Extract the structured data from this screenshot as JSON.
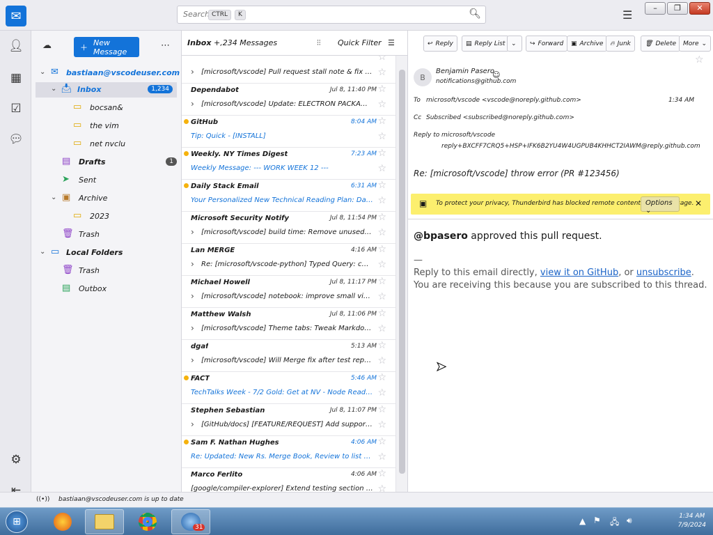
{
  "search": {
    "placeholder": "Search…",
    "kbd1": "CTRL",
    "kbd2": "K"
  },
  "spaces": [
    "mail-icon",
    "address-book-icon",
    "calendar-icon",
    "tasks-icon",
    "chat-icon"
  ],
  "folders": {
    "new_message": "New Message",
    "account": "bastiaan@vscodeuser.com",
    "inbox": "Inbox",
    "inbox_count": "1,234",
    "sub1": "bocsan&",
    "sub2": "the vim",
    "sub3": "net nvclu",
    "drafts": "Drafts",
    "drafts_count": "1",
    "sent": "Sent",
    "archive": "Archive",
    "archive_sub": "2023",
    "trash": "Trash",
    "local": "Local Folders",
    "local_trash": "Trash",
    "outbox": "Outbox"
  },
  "list": {
    "title": "Inbox",
    "count": "+,234 Messages",
    "quick_filter": "Quick Filter",
    "rows": [
      {
        "from": "",
        "date": "",
        "subj": "[microsoft/vscode] Pull request stall note & fix (…",
        "unread": false,
        "dot": false,
        "expand": true
      },
      {
        "from": "Dependabot",
        "date": "Jul 8, 11:40 PM",
        "subj": "[microsoft/vscode] Update: ELECTRON PACKAGE INFO…",
        "unread": false,
        "dot": false,
        "expand": true
      },
      {
        "from": "GitHub",
        "date": "8:04 AM",
        "subj": "Tip: Quick - [INSTALL]",
        "unread": true,
        "dot": true,
        "expand": false
      },
      {
        "from": "Weekly. NY Times Digest",
        "date": "7:23 AM",
        "subj": "Weekly Message: --- WORK WEEK 12 ---",
        "unread": true,
        "dot": true,
        "expand": false
      },
      {
        "from": "Daily Stack Email",
        "date": "6:31 AM",
        "subj": "Your Personalized New Technical Reading Plan: Day 5",
        "unread": true,
        "dot": true,
        "expand": false
      },
      {
        "from": "Microsoft Security Notify",
        "date": "Jul 8, 11:54 PM",
        "subj": "[microsoft/vscode] build time: Remove unused symbols (PR …",
        "unread": false,
        "dot": false,
        "expand": true
      },
      {
        "from": "Lan MERGE",
        "date": "4:16 AM",
        "subj": "Re: [microsoft/vscode-python] Typed Query: correct import logic…",
        "unread": false,
        "dot": false,
        "expand": true
      },
      {
        "from": "Michael Howell",
        "date": "Jul 8, 11:17 PM",
        "subj": "[microsoft/vscode] notebook: improve small view small section tabs…",
        "unread": false,
        "dot": false,
        "expand": true
      },
      {
        "from": "Matthew Walsh",
        "date": "Jul 8, 11:06 PM",
        "subj": "[microsoft/vscode] Theme tabs: Tweak Markdown colors in the…",
        "unread": false,
        "dot": false,
        "expand": true
      },
      {
        "from": "dgaf",
        "date": "5:13 AM",
        "subj": "[microsoft/vscode] Will Merge fix after test reporting (…",
        "unread": false,
        "dot": false,
        "expand": true
      },
      {
        "from": "FACT",
        "date": "5:46 AM",
        "subj": "TechTalks Week - 7/2 Gold: Get at NV - Node Reading Ed…",
        "unread": true,
        "dot": true,
        "expand": false
      },
      {
        "from": "Stephen Sebastian",
        "date": "Jul 8, 11:07 PM",
        "subj": "[GitHub/docs] [FEATURE/REQUEST] Add support…",
        "unread": false,
        "dot": false,
        "expand": true
      },
      {
        "from": "Sam F. Nathan Hughes",
        "date": "4:06 AM",
        "subj": "Re: Updated: New Rs. Merge Book, Review to list by…",
        "unread": true,
        "dot": true,
        "expand": false
      },
      {
        "from": "Marco Ferlito",
        "date": "4:06 AM",
        "subj": "[google/compiler-explorer] Extend testing section (PR…",
        "unread": false,
        "dot": false,
        "expand": false
      }
    ]
  },
  "reader": {
    "toolbar": [
      "Reply",
      "Reply List",
      "Forward",
      "Archive",
      "Junk",
      "Delete",
      "More"
    ],
    "from_name": "Benjamin Pasero",
    "from_email": "notifications@github.com",
    "to_label": "To",
    "to_value": "microsoft/vscode <vscode@noreply.github.com>",
    "date": "1:34 AM",
    "cc_label": "Cc",
    "cc_value": "Subscribed <subscribed@noreply.github.com>",
    "replyto_label": "Reply to",
    "replyto_line1": "microsoft/vscode",
    "replyto_line2": "reply+BXCFF7CRQ5+HSP+IFK6B2YU4W4UGPUB4KHHCT2IAWM@reply.github.com",
    "subject": "Re: [microsoft/vscode] throw error (PR #123456)",
    "notice": "To protect your privacy, Thunderbird has blocked remote content in this message.",
    "notice_btn": "Options",
    "approver": "@bpasero",
    "approve_text": " approved this pull request.",
    "sig": "—",
    "reply_pre": "Reply to this email directly, ",
    "link1": "view it on GitHub",
    "reply_mid": ", or ",
    "link2": "unsubscribe",
    "reply_post": ".",
    "sub_text": "You are receiving this because you are subscribed to this thread."
  },
  "status": {
    "text": "bastiaan@vscodeuser.com is up to date"
  },
  "taskbar": {
    "thunderbird_badge": "31",
    "clock_time": "1:34 AM",
    "clock_date": "7/9/2024"
  }
}
